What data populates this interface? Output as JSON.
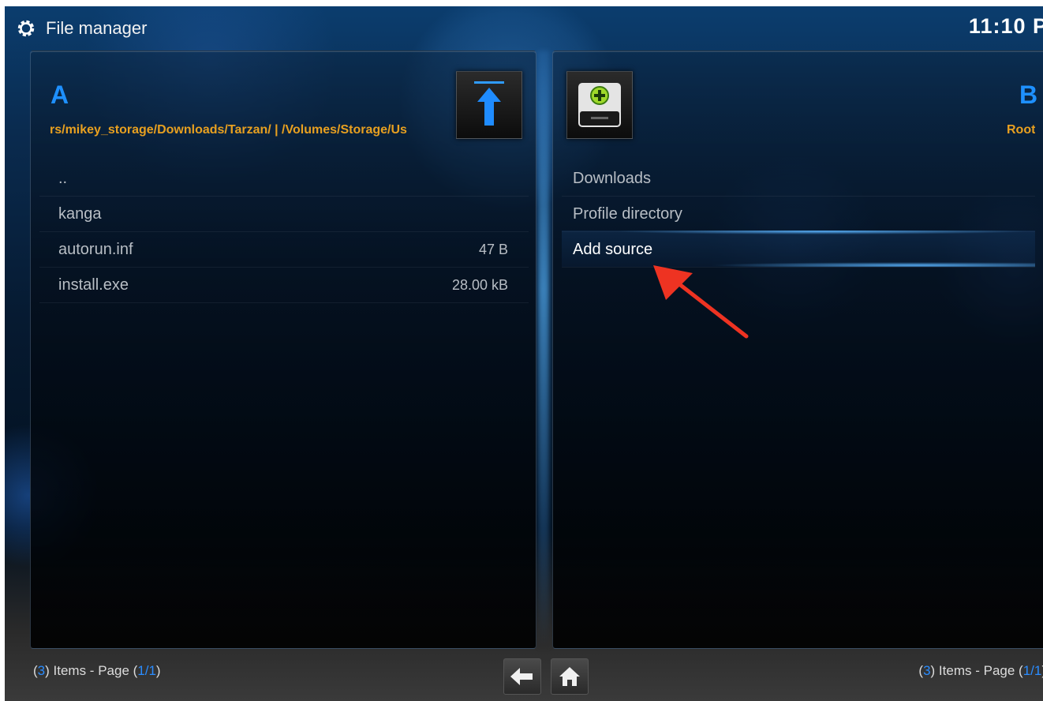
{
  "header": {
    "title": "File manager",
    "clock": "11:10 P"
  },
  "pane_a": {
    "letter": "A",
    "path": "rs/mikey_storage/Downloads/Tarzan/ | /Volumes/Storage/Us",
    "items": [
      {
        "name": "..",
        "size": ""
      },
      {
        "name": "kanga",
        "size": ""
      },
      {
        "name": "autorun.inf",
        "size": "47  B"
      },
      {
        "name": "install.exe",
        "size": "28.00 kB"
      }
    ],
    "footer": {
      "count": "3",
      "pre": "(",
      "mid": ") Items - Page (",
      "page": "1/1",
      "post": ")"
    }
  },
  "pane_b": {
    "letter": "B",
    "path": "Root",
    "items": [
      {
        "name": "Downloads"
      },
      {
        "name": "Profile directory"
      },
      {
        "name": "Add source"
      }
    ],
    "footer": {
      "count": "3",
      "pre": "(",
      "mid": ") Items - Page (",
      "page": "1/1",
      "post": ")"
    }
  },
  "icons": {
    "header": "gear-icon",
    "pane_a_thumb": "parent-folder-up-arrow-icon",
    "pane_b_thumb": "add-drive-icon",
    "back": "back-arrow-icon",
    "home": "home-icon",
    "annotation": "red-arrow-annotation"
  },
  "colors": {
    "accent": "#1e90ff",
    "path": "#e8a020",
    "annotation": "#ee3322"
  }
}
